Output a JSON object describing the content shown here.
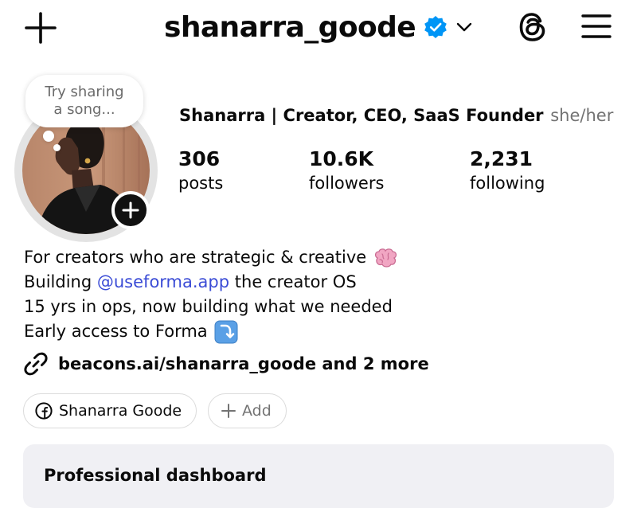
{
  "header": {
    "username": "shanarra_goode",
    "verified": true,
    "icons": [
      "plus-icon",
      "verified-badge-icon",
      "chevron-down-icon",
      "threads-icon",
      "menu-icon"
    ]
  },
  "note": {
    "line1": "Try sharing",
    "line2": "a song..."
  },
  "profile": {
    "display_name": "Shanarra | Creator, CEO, SaaS Founder",
    "pronouns": "she/her",
    "stats": [
      {
        "value": "306",
        "label": "posts"
      },
      {
        "value": "10.6K",
        "label": "followers"
      },
      {
        "value": "2,231",
        "label": "following"
      }
    ]
  },
  "bio": {
    "line1": "For creators who are strategic & creative",
    "line1_emoji": "🧠",
    "line2_prefix": "Building ",
    "line2_mention": "@useforma.app",
    "line2_suffix": " the creator OS",
    "line3": "15 yrs in ops, now building what we needed",
    "line4": "Early access to Forma",
    "line4_emoji": "⤵️",
    "link": "beacons.ai/shanarra_goode and 2 more"
  },
  "chips": {
    "facebook_label": "Shanarra Goode",
    "add_label": "Add"
  },
  "dashboard": {
    "title": "Professional dashboard"
  },
  "colors": {
    "verified_blue": "#0095f6",
    "mention": "#3b4cd6",
    "muted": "#737373",
    "dashboard_bg": "#f0f0f4"
  }
}
